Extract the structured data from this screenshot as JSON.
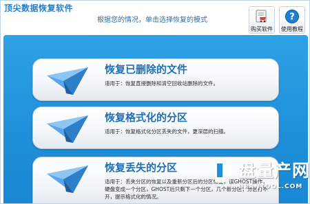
{
  "app": {
    "title": "顶尖数据恢复软件",
    "instruction": "根据您的情况，单击选择恢复的模式"
  },
  "header_buttons": {
    "buy": {
      "label": "购买软件",
      "icon": "cart-icon"
    },
    "help": {
      "label": "使用教程",
      "icon": "help-icon"
    }
  },
  "modes": [
    {
      "title": "恢复已删除的文件",
      "desc": "适用于：恢复直接删除和清空回收站删除的文件。",
      "icon": "paper-plane-icon"
    },
    {
      "title": "恢复格式化的分区",
      "desc": "适用于：恢复格式化分区丢失的文件，更深层的扫描。",
      "icon": "paper-plane-icon"
    },
    {
      "title": "恢复丢失的分区",
      "desc": "适用于：丢失分区的恢复以及重新分区后的分区恢复，误GHOST操作，硬盘变成一个分区，GHOST后只剩下一个分区，几个新分区；分区打不开，提示格式化的情况。",
      "icon": "paper-plane-icon"
    }
  ],
  "watermark": {
    "text": "盘量产网",
    "url": "UPANTOOL.COM"
  },
  "colors": {
    "panel_blue": "#1e8fd9",
    "title_blue": "#2a7cc7",
    "card_title_blue": "#1f6fb5",
    "help_red": "#d9262a"
  }
}
